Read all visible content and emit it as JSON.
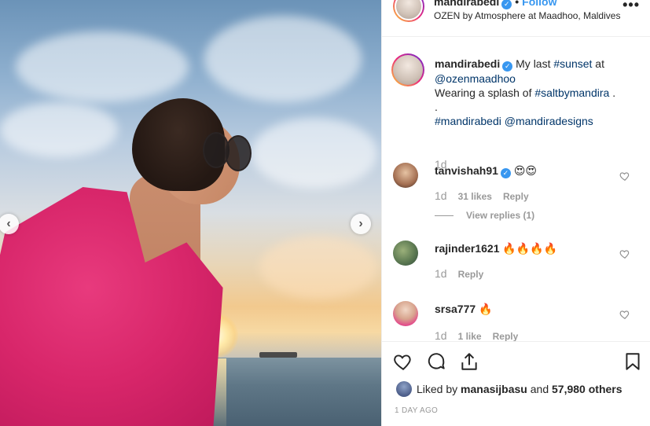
{
  "header": {
    "username": "mandirabedi",
    "dot": "•",
    "follow_label": "Follow",
    "location": "OZEN by Atmosphere at Maadhoo, Maldives",
    "more_label": "•••"
  },
  "photo": {
    "prev_label": "‹",
    "next_label": "›"
  },
  "caption": {
    "username": "mandirabedi",
    "text1": "My last ",
    "hashtag_sunset": "#sunset",
    "text2": " at",
    "mention_ozen": "@ozenmaadhoo",
    "line2_text": "Wearing a splash of ",
    "hashtag_salt": "#saltbymandira",
    "line2_end": " .",
    "dot_line": ".",
    "hashtag_mandirabedi": "#mandirabedi",
    "mention_designs": "@mandiradesigns",
    "time": "1d"
  },
  "comments": [
    {
      "username": "tanvishah91",
      "text": "😍😍",
      "time": "1d",
      "likes": "31 likes",
      "reply": "Reply",
      "view_replies": "View replies (1)"
    },
    {
      "username": "rajinder1621",
      "text": "🔥🔥🔥🔥",
      "time": "1d",
      "reply": "Reply"
    },
    {
      "username": "srsa777",
      "text": "🔥",
      "time": "1d",
      "likes": "1 like",
      "reply": "Reply"
    }
  ],
  "footer": {
    "liked_prefix": "Liked by ",
    "liked_user": "manasijbasu",
    "liked_mid": " and ",
    "liked_count": "57,980 others",
    "ago": "1 DAY AGO"
  },
  "icons": {
    "like": "heart-icon",
    "comment": "comment-icon",
    "share": "share-icon",
    "save": "bookmark-icon",
    "verified": "verified-badge-icon",
    "more": "more-options-icon"
  },
  "colors": {
    "accent": "#3897f0",
    "link": "#003569",
    "muted": "#999999",
    "text": "#262626",
    "border": "#efefef"
  }
}
